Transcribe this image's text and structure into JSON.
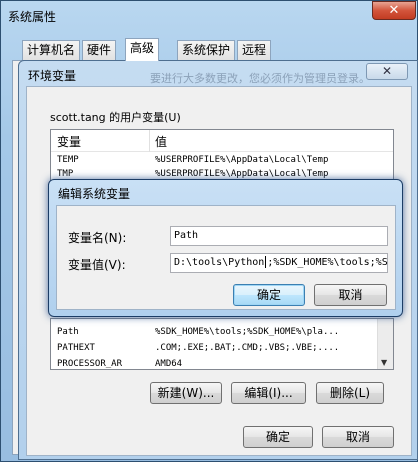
{
  "system_properties": {
    "title": "系统属性",
    "close_label": "✕",
    "tabs": [
      "计算机名",
      "硬件",
      "高级",
      "系统保护",
      "远程"
    ]
  },
  "env_window": {
    "title": "环境变量",
    "close_label": "✕",
    "background_text": "要进行大多数更改，您必须作为管理员登录。",
    "user_group_label": "scott.tang 的用户变量(U)",
    "columns": [
      "变量",
      "值"
    ],
    "user_vars": [
      {
        "name": "TEMP",
        "value": "%USERPROFILE%\\AppData\\Local\\Temp"
      },
      {
        "name": "TMP",
        "value": "%USERPROFILE%\\AppData\\Local\\Temp"
      }
    ],
    "system_vars": [
      {
        "name": "Path",
        "value": "%SDK_HOME%\\tools;%SDK_HOME%\\pla..."
      },
      {
        "name": "PATHEXT",
        "value": ".COM;.EXE;.BAT;.CMD;.VBS;.VBE;...."
      },
      {
        "name": "PROCESSOR_AR",
        "value": "AMD64"
      }
    ],
    "new_button": "新建(W)...",
    "edit_button": "编辑(I)...",
    "delete_button": "删除(L)",
    "ok_button": "确定",
    "cancel_button": "取消"
  },
  "edit_dialog": {
    "title": "编辑系统变量",
    "name_label": "变量名(N):",
    "name_value": "Path",
    "value_label": "变量值(V):",
    "value_before_caret": "D:\\tools\\Python",
    "value_after_caret": ";%SDK_HOME%\\tools;%SI",
    "ok_button": "确定",
    "cancel_button": "取消"
  }
}
